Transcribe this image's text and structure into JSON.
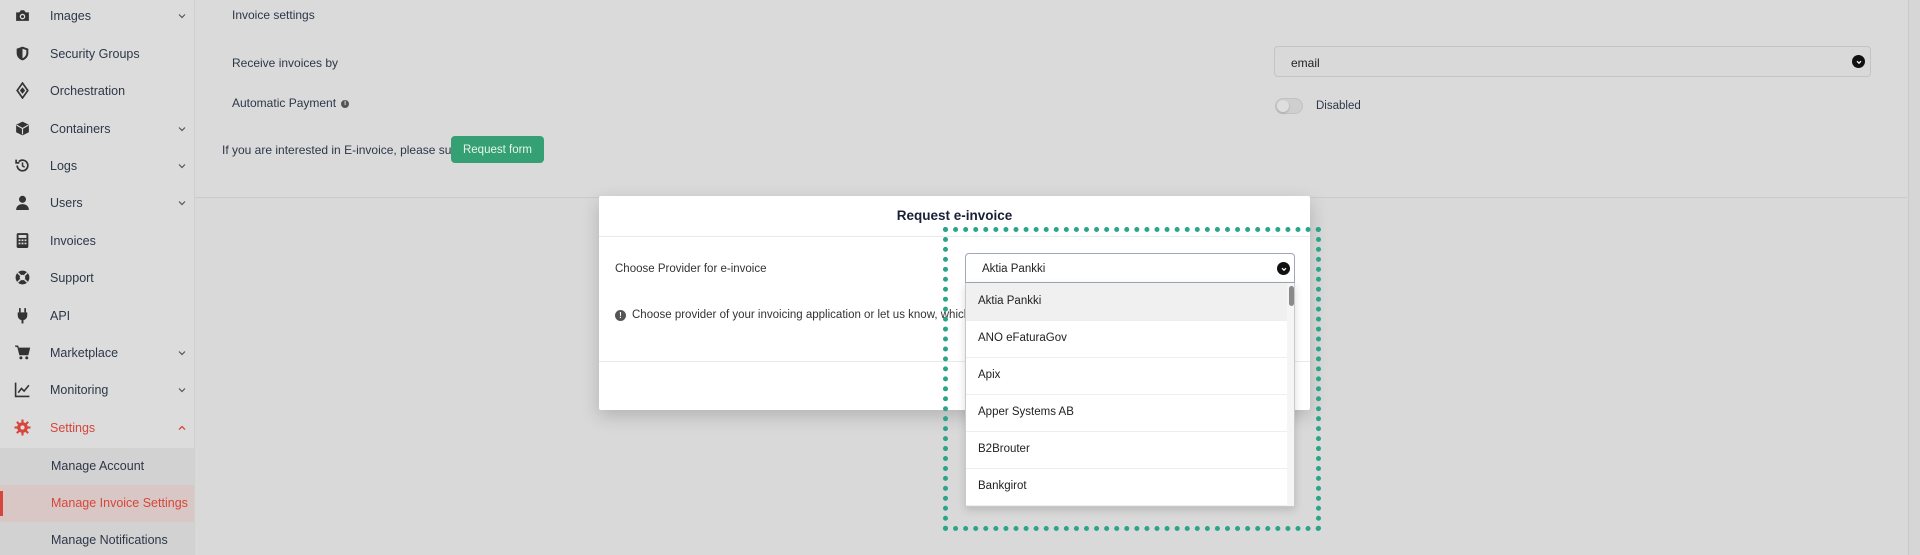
{
  "sidebar": {
    "items": [
      {
        "label": "Images",
        "icon": "camera-icon",
        "chevron": true
      },
      {
        "label": "Security Groups",
        "icon": "shield-icon",
        "chevron": false
      },
      {
        "label": "Orchestration",
        "icon": "layers-icon",
        "chevron": false
      },
      {
        "label": "Containers",
        "icon": "cube-icon",
        "chevron": true
      },
      {
        "label": "Logs",
        "icon": "history-icon",
        "chevron": true
      },
      {
        "label": "Users",
        "icon": "user-icon",
        "chevron": true
      },
      {
        "label": "Invoices",
        "icon": "calculator-icon",
        "chevron": false
      },
      {
        "label": "Support",
        "icon": "lifebuoy-icon",
        "chevron": false
      },
      {
        "label": "API",
        "icon": "plug-icon",
        "chevron": false
      },
      {
        "label": "Marketplace",
        "icon": "cart-icon",
        "chevron": true
      },
      {
        "label": "Monitoring",
        "icon": "chart-line-icon",
        "chevron": true
      },
      {
        "label": "Settings",
        "icon": "gear-icon",
        "chevron": true,
        "active": true
      }
    ],
    "subitems": [
      {
        "label": "Manage Account"
      },
      {
        "label": "Manage Invoice Settings",
        "active": true
      },
      {
        "label": "Manage Notifications"
      }
    ],
    "accent_color": "#d6463c"
  },
  "invoice_settings": {
    "heading": "Invoice settings",
    "receive_label": "Receive invoices by",
    "receive_value": "email",
    "auto_payment_label": "Automatic Payment",
    "auto_payment_state": "Disabled",
    "einvoice_text": "If you are interested in E-invoice, please submit",
    "request_button": "Request form",
    "button_color": "#35a073"
  },
  "modal": {
    "title": "Request e-invoice",
    "provider_label": "Choose Provider for e-invoice",
    "help_text": "Choose provider of your invoicing application or let us know, which form",
    "selected_provider": "Aktia Pankki",
    "options": [
      "Aktia Pankki",
      "ANO eFaturaGov",
      "Apix",
      "Apper Systems AB",
      "B2Brouter",
      "Bankgirot"
    ]
  },
  "highlight_color": "#2aa58a"
}
